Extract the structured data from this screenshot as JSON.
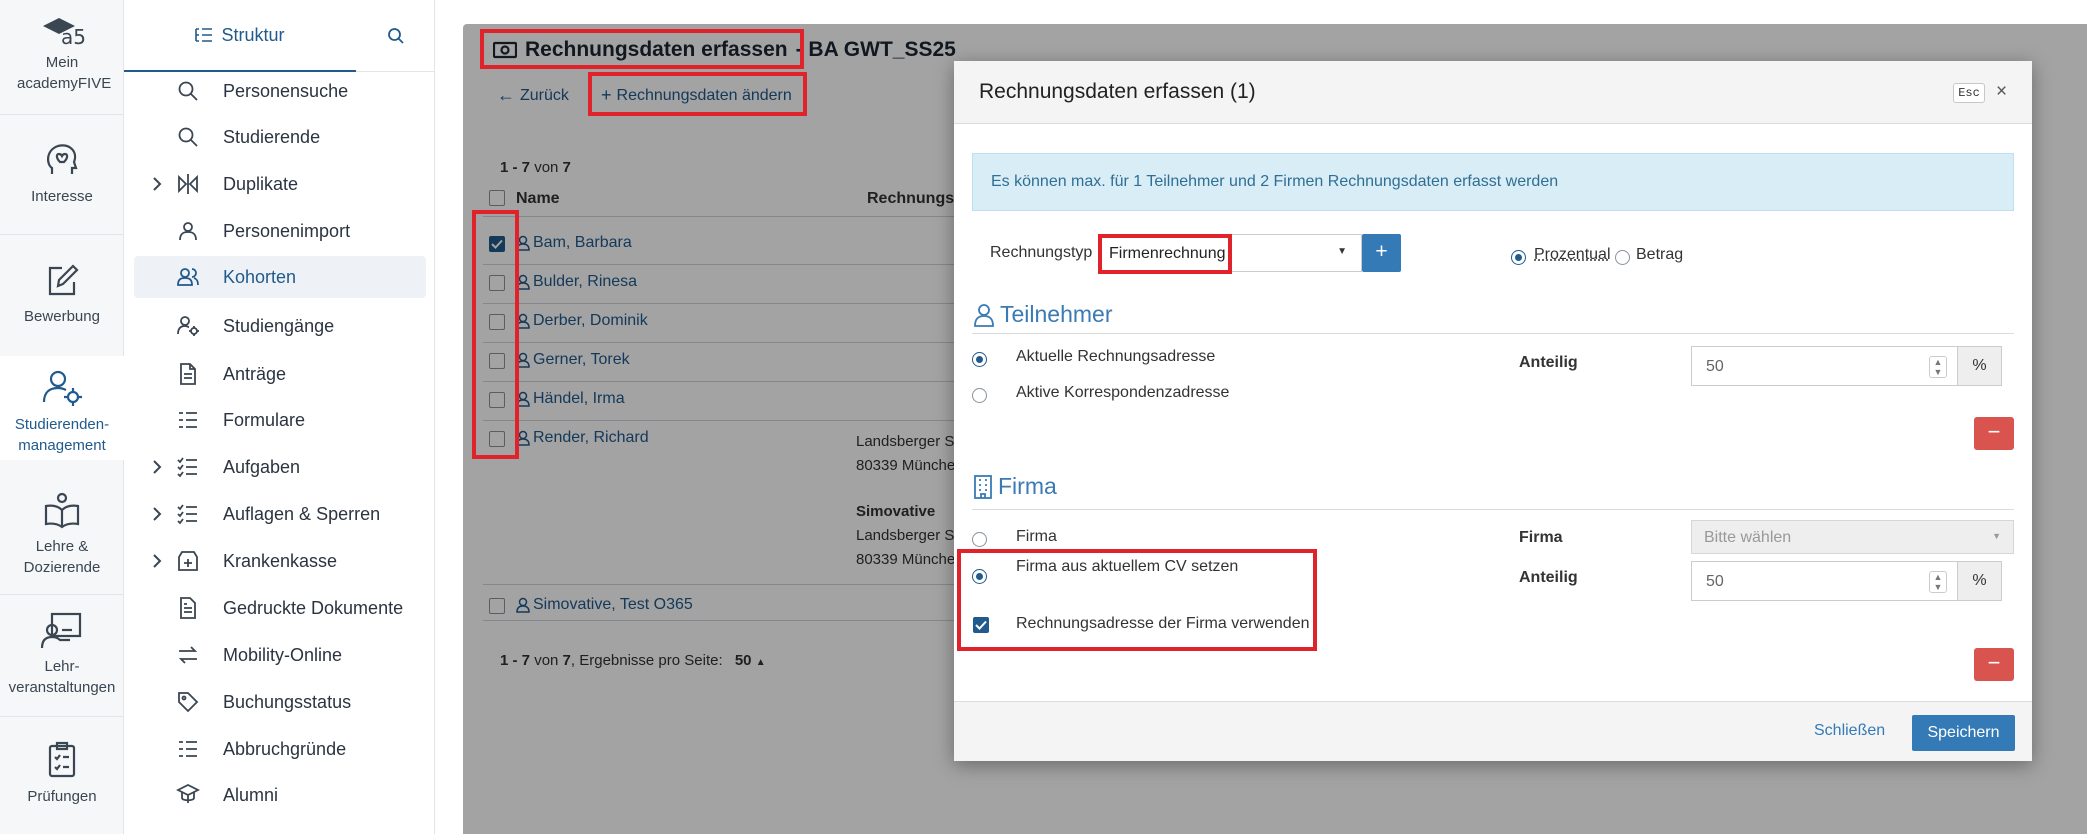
{
  "rail": {
    "items": [
      {
        "label": "Mein academyFIVE",
        "icon": "academyfive-logo-icon"
      },
      {
        "label": "Interesse",
        "icon": "heart-head-icon"
      },
      {
        "label": "Bewerbung",
        "icon": "edit-icon"
      },
      {
        "label": "Studierenden-management",
        "icon": "users-gear-icon"
      },
      {
        "label": "Lehre & Dozierende",
        "icon": "open-book-icon"
      },
      {
        "label": "Lehr-veranstaltungen",
        "icon": "presentation-icon"
      },
      {
        "label": "Prüfungen",
        "icon": "clipboard-check-icon"
      }
    ]
  },
  "nav": {
    "tab_label": "Struktur",
    "items": [
      {
        "label": "Personensuche",
        "icon": "search-icon",
        "expandable": false
      },
      {
        "label": "Studierende",
        "icon": "search-icon",
        "expandable": false
      },
      {
        "label": "Duplikate",
        "icon": "compare-icon",
        "expandable": true
      },
      {
        "label": "Personenimport",
        "icon": "person-import-icon",
        "expandable": false
      },
      {
        "label": "Kohorten",
        "icon": "users-icon",
        "expandable": false,
        "active": true
      },
      {
        "label": "Studiengänge",
        "icon": "person-gear-icon",
        "expandable": false
      },
      {
        "label": "Anträge",
        "icon": "document-icon",
        "expandable": false
      },
      {
        "label": "Formulare",
        "icon": "list-icon",
        "expandable": false
      },
      {
        "label": "Aufgaben",
        "icon": "checklist-icon",
        "expandable": true
      },
      {
        "label": "Auflagen & Sperren",
        "icon": "checklist-icon",
        "expandable": true
      },
      {
        "label": "Krankenkasse",
        "icon": "health-icon",
        "expandable": true
      },
      {
        "label": "Gedruckte Dokumente",
        "icon": "printed-doc-icon",
        "expandable": false
      },
      {
        "label": "Mobility-Online",
        "icon": "swap-icon",
        "expandable": false
      },
      {
        "label": "Buchungsstatus",
        "icon": "tag-icon",
        "expandable": false
      },
      {
        "label": "Abbruchgründe",
        "icon": "list-icon",
        "expandable": false
      },
      {
        "label": "Alumni",
        "icon": "graduate-icon",
        "expandable": false
      }
    ]
  },
  "page": {
    "title": "Rechnungsdaten erfassen",
    "title_suffix": "- BA GWT_SS25",
    "back_label": "Zurück",
    "change_label": "Rechnungsdaten ändern",
    "count_text": "1 - 7",
    "count_of": "von",
    "count_total": "7",
    "col_name": "Name",
    "col_rechnung": "Rechnungsa",
    "persons": [
      {
        "name": "Bam, Barbara",
        "checked": true
      },
      {
        "name": "Bulder, Rinesa",
        "checked": false
      },
      {
        "name": "Derber, Dominik",
        "checked": false
      },
      {
        "name": "Gerner, Torek",
        "checked": false
      },
      {
        "name": "Händel, Irma",
        "checked": false
      },
      {
        "name": "Render, Richard",
        "checked": false
      }
    ],
    "addr1_line1": "Landsberger S",
    "addr1_line2": "80339 Münche",
    "addr2_company": "Simovative",
    "addr2_line1": "Landsberger S",
    "addr2_line2": "80339 Münche",
    "last_person": "Simovative, Test O365",
    "footer_text": "1 - 7",
    "footer_of": "von",
    "footer_total": "7",
    "footer_per_page": ", Ergebnisse pro Seite:",
    "footer_page_size": "50"
  },
  "modal": {
    "title": "Rechnungsdaten erfassen (1)",
    "esc": "Esc",
    "close": "×",
    "info": "Es können max. für 1 Teilnehmer und 2 Firmen Rechnungsdaten erfasst werden",
    "rechnungstyp_label": "Rechnungstyp",
    "rechnungstyp_value": "Firmenrechnung",
    "add_label": "+",
    "mode_prozentual": "Prozentual",
    "mode_betrag": "Betrag",
    "teilnehmer": {
      "title": "Teilnehmer",
      "opt_current": "Aktuelle Rechnungsadresse",
      "opt_active": "Aktive Korrespondenzadresse",
      "anteilig_label": "Anteilig",
      "anteilig_value": "50",
      "unit": "%",
      "remove": "−"
    },
    "firma": {
      "title": "Firma",
      "opt_firma": "Firma",
      "opt_cv": "Firma aus aktuellem CV setzen",
      "check_address": "Rechnungsadresse der Firma verwenden",
      "firma_label": "Firma",
      "firma_placeholder": "Bitte wählen",
      "anteilig_label": "Anteilig",
      "anteilig_value": "50",
      "unit": "%",
      "remove": "−"
    },
    "close_label": "Schließen",
    "save_label": "Speichern"
  },
  "colors": {
    "accent": "#215a8c",
    "highlight": "#e0222b",
    "info_bg": "#d9edf7",
    "danger": "#d9534f",
    "primary_btn": "#337ab7"
  }
}
